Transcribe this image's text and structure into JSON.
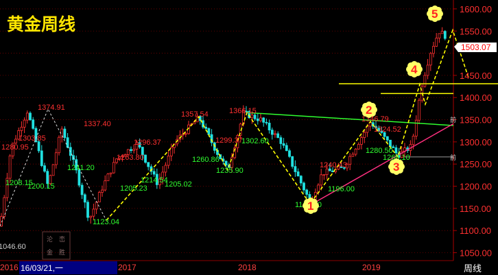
{
  "chart_data": {
    "type": "candlestick",
    "title": "黄金周线",
    "period_label": "周线",
    "y_axis": {
      "range": [
        1010,
        1610
      ],
      "ticks": [
        1600.0,
        1550.0,
        1500.0,
        1450.0,
        1400.0,
        1350.0,
        1300.0,
        1250.0,
        1200.0,
        1150.0,
        1100.0,
        1050.0
      ],
      "tick_labels": [
        "1600.00",
        "1550.00",
        "1503.07",
        "1450.00",
        "1400.00",
        "1350.00",
        "1300.00",
        "1250.00",
        "1200.00",
        "1150.00",
        "1100.00",
        "1050.00"
      ]
    },
    "x_axis": {
      "labels": [
        "2016",
        "16/03/21,一",
        "2017",
        "2018",
        "2019"
      ]
    },
    "current_price": "1503.07",
    "left_edge_value": "1046.60",
    "annotations": [
      {
        "text": "1374.91",
        "color": "#ff3030",
        "price": 1374.91
      },
      {
        "text": "1303.85",
        "color": "#ff3030",
        "price": 1303.85
      },
      {
        "text": "1280.95",
        "color": "#ff3030",
        "price": 1280.95
      },
      {
        "text": "1337.40",
        "color": "#ff3030",
        "price": 1337.4
      },
      {
        "text": "1241.20",
        "color": "#30ff30",
        "price": 1241.2
      },
      {
        "text": "1208.15",
        "color": "#30ff30",
        "price": 1208.15
      },
      {
        "text": "1200.15",
        "color": "#30ff30",
        "price": 1200.15
      },
      {
        "text": "1123.04",
        "color": "#30ff30",
        "price": 1123.04
      },
      {
        "text": "1263.80",
        "color": "#ff3030",
        "price": 1263.8
      },
      {
        "text": "1296.37",
        "color": "#ff3030",
        "price": 1296.37
      },
      {
        "text": "1205.23",
        "color": "#30ff30",
        "price": 1205.23
      },
      {
        "text": "1214.54",
        "color": "#30ff30",
        "price": 1214.54
      },
      {
        "text": "1205.02",
        "color": "#30ff30",
        "price": 1205.02
      },
      {
        "text": "1357.54",
        "color": "#ff3030",
        "price": 1357.54
      },
      {
        "text": "1260.86",
        "color": "#30ff30",
        "price": 1260.86
      },
      {
        "text": "1299.37",
        "color": "#ff3030",
        "price": 1299.37
      },
      {
        "text": "1235.90",
        "color": "#30ff30",
        "price": 1235.9
      },
      {
        "text": "1302.60",
        "color": "#30ff30",
        "price": 1302.6
      },
      {
        "text": "1366.15",
        "color": "#ff3030",
        "price": 1366.15
      },
      {
        "text": "1240.43",
        "color": "#ff3030",
        "price": 1240.43
      },
      {
        "text": "1196.00",
        "color": "#30ff30",
        "price": 1196.0
      },
      {
        "text": "1160.00",
        "color": "#30ff30",
        "price": 1160.0
      },
      {
        "text": "1346.79",
        "color": "#ff3030",
        "price": 1346.79
      },
      {
        "text": "1324.52",
        "color": "#ff3030",
        "price": 1324.52
      },
      {
        "text": "1280.50",
        "color": "#30ff30",
        "price": 1280.5
      },
      {
        "text": "1266.10",
        "color": "#30ff30",
        "price": 1266.1
      }
    ],
    "wave_points": [
      "1",
      "2",
      "3",
      "4",
      "5"
    ],
    "legend_stub": "前",
    "stamp_text": [
      "沦",
      "峦",
      "金",
      "胜"
    ]
  }
}
